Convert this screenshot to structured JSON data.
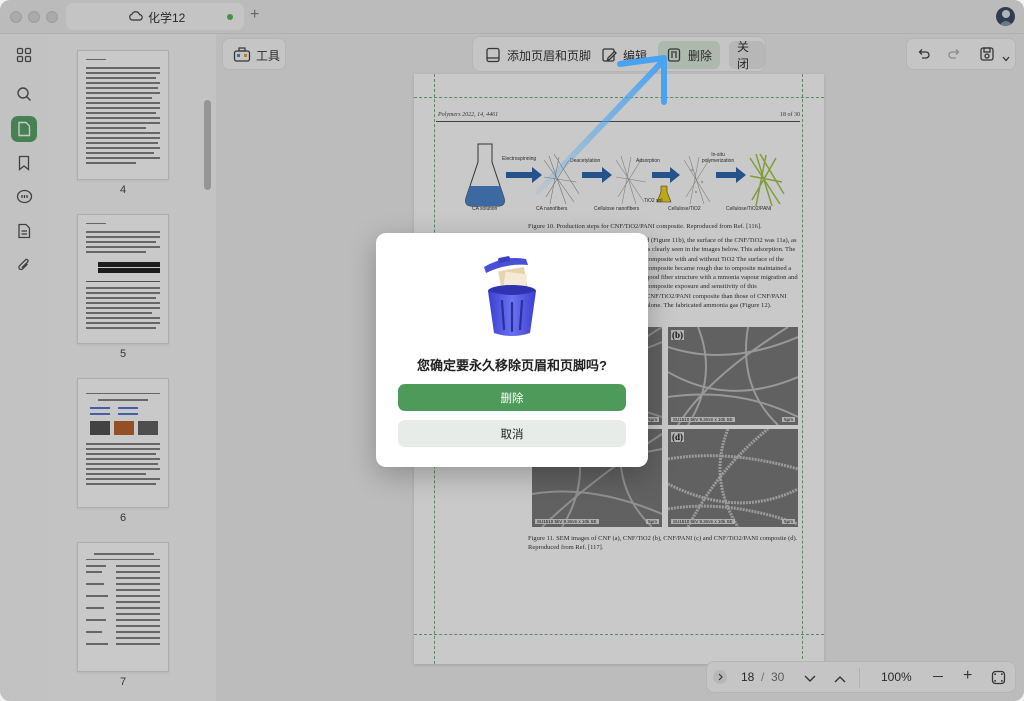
{
  "window": {
    "tab_title": "化学12"
  },
  "toolbar_left": {
    "tools_label": "工具"
  },
  "edit_toolbar": {
    "add_header_footer": "添加页眉和页脚",
    "edit": "编辑",
    "delete": "删除",
    "close": "关闭"
  },
  "thumbnails": [
    {
      "page": "4"
    },
    {
      "page": "5"
    },
    {
      "page": "6"
    },
    {
      "page": "7"
    }
  ],
  "document": {
    "header_journal": "Polymers 2022, 14, 4461",
    "header_page": "18 of 30",
    "fig10": {
      "steps": [
        "Electrospinning",
        "Deacetylation",
        "Adsorption",
        "In-situ polymerization"
      ],
      "labels": [
        "CA  solution",
        "CA  nanofibers",
        "Cellulose  nanofibers",
        "TiO2 sol",
        "Cellulose/TiO2",
        "Cellulose/TiO2/PANI"
      ],
      "caption": "Figure 10. Production steps for CNF/TiO2/PANI composite. Reproduced from Ref. [116]."
    },
    "body": "d (Figure 11b), the surface of the CNF/TiO2 was 11a), as is clearly seen in the images below. This adsorption. The composite with and without TiO2 The surface of the composite became rough due to omposite maintained a good fiber structure with a mmonia vapour migration and composite exposure and sensitivity of this CNF/TiO2/PANI composite than those of CNF/PANI alone. The fabricated ammonia gas (Figure 12).",
    "sem_panels": [
      {
        "tag": "(b)",
        "info": "SU1510 5kV 9.3mm x 10k SE",
        "scale": "5μm"
      },
      {
        "tag": "(d)",
        "info": "SU1510 5kV 9.3mm x 10k SE",
        "scale": "5μm"
      },
      {
        "tag": "",
        "info": "SU1510 5kV 9.3mm x 10k SE",
        "scale": "5μm"
      },
      {
        "tag": "",
        "info": "SU1510 5kV 9.3mm x 10k SE",
        "scale": "5μm"
      }
    ],
    "fig11_caption": "Figure 11. SEM images of CNF (a), CNF/TiO2 (b), CNF/PANI (c) and CNF/TiO2/PANI composite (d). Reproduced from Ref. [117]."
  },
  "bottom_nav": {
    "current_page": "18",
    "separator": "/",
    "total_pages": "30",
    "zoom": "100%"
  },
  "dialog": {
    "message": "您确定要永久移除页眉和页脚吗?",
    "confirm": "删除",
    "cancel": "取消"
  },
  "colors": {
    "accent": "#4e9a5a",
    "selected_tool_bg": "#d9e9d9",
    "trash_icon": "#4a4fd8",
    "annotation_arrow": "#4aa3f0"
  }
}
